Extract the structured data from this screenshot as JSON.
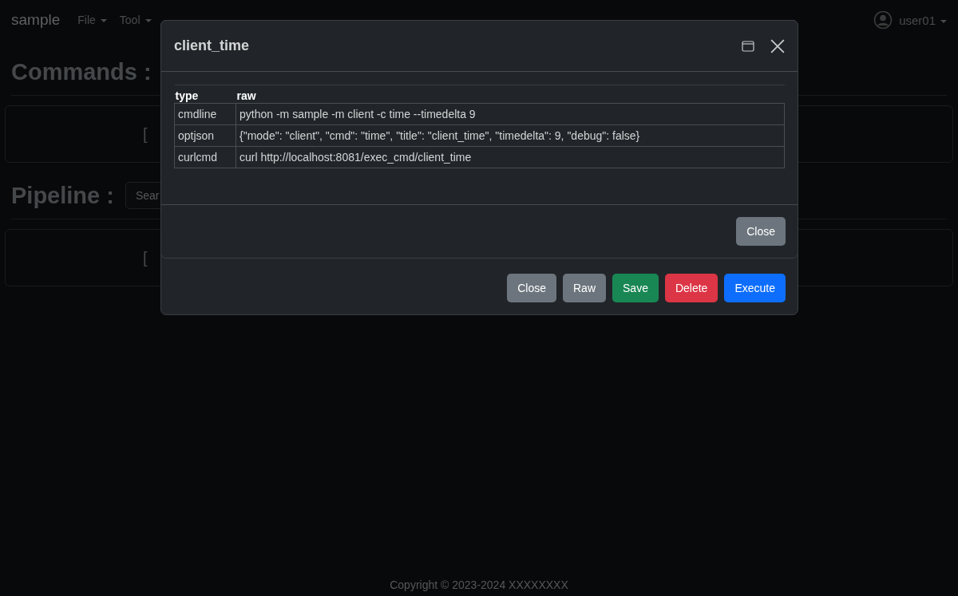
{
  "navbar": {
    "brand": "sample",
    "menus": [
      {
        "label": "File"
      },
      {
        "label": "Tool"
      }
    ],
    "user": "user01"
  },
  "sections": [
    {
      "title": "Commands :",
      "card_text": "["
    },
    {
      "title": "Pipeline :",
      "search": {
        "placeholder": "Sear"
      },
      "card_text": "["
    }
  ],
  "footer": "Copyright © 2023-2024 XXXXXXXX",
  "outer_modal": {
    "buttons": [
      {
        "label": "Close",
        "kind": "secondary"
      },
      {
        "label": "Raw",
        "kind": "secondary"
      },
      {
        "label": "Save",
        "kind": "success"
      },
      {
        "label": "Delete",
        "kind": "danger"
      },
      {
        "label": "Execute",
        "kind": "primary"
      }
    ]
  },
  "inner_modal": {
    "title": "client_time",
    "table": {
      "columns": [
        "type",
        "raw"
      ],
      "rows": [
        [
          "cmdline",
          "python -m sample -m client -c time --timedelta 9"
        ],
        [
          "optjson",
          "{\"mode\": \"client\", \"cmd\": \"time\", \"title\": \"client_time\", \"timedelta\": 9, \"debug\": false}"
        ],
        [
          "curlcmd",
          "curl http://localhost:8081/exec_cmd/client_time"
        ]
      ]
    },
    "button": {
      "label": "Close",
      "kind": "secondary"
    }
  }
}
